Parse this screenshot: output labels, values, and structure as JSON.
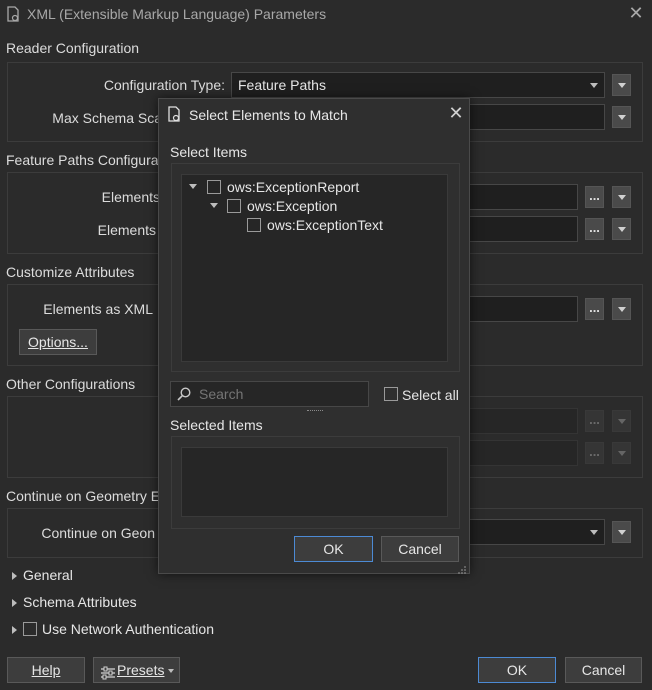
{
  "window": {
    "title": "XML (Extensible Markup Language) Parameters",
    "close_glyph": "✕"
  },
  "reader_config": {
    "heading": "Reader Configuration",
    "config_type_label": "Configuration Type:",
    "config_type_value": "Feature Paths",
    "max_schema_label": "Max Schema Sca"
  },
  "feature_paths": {
    "heading": "Feature Paths Configurat",
    "elements_label_1": "Elements",
    "elements_label_2": "Elements"
  },
  "customize_attributes": {
    "heading": "Customize Attributes",
    "elements_as_xml_label": "Elements as XML",
    "options_button": "Options..."
  },
  "other_configurations": {
    "heading": "Other Configurations"
  },
  "continue_geometry": {
    "heading": "Continue on Geometry E",
    "label": "Continue on Geon"
  },
  "collapsibles": {
    "general": "General",
    "schema_attributes": "Schema Attributes",
    "use_network_auth": "Use Network Authentication"
  },
  "footer": {
    "help": "Help",
    "presets": "Presets",
    "ok": "OK",
    "cancel": "Cancel"
  },
  "dots_glyph": "...",
  "modal": {
    "title": "Select Elements to Match",
    "close_glyph": "✕",
    "select_items_label": "Select Items",
    "tree": [
      {
        "label": "ows:ExceptionReport",
        "level": 0,
        "expanded": true
      },
      {
        "label": "ows:Exception",
        "level": 1,
        "expanded": true
      },
      {
        "label": "ows:ExceptionText",
        "level": 2,
        "expanded": false
      }
    ],
    "search_placeholder": "Search",
    "select_all_label": "Select all",
    "selected_items_label": "Selected Items",
    "ok": "OK",
    "cancel": "Cancel"
  },
  "colors": {
    "background": "#2b2b2b",
    "accent_border": "#4c8ad4",
    "input_background": "#1f1f1f"
  }
}
